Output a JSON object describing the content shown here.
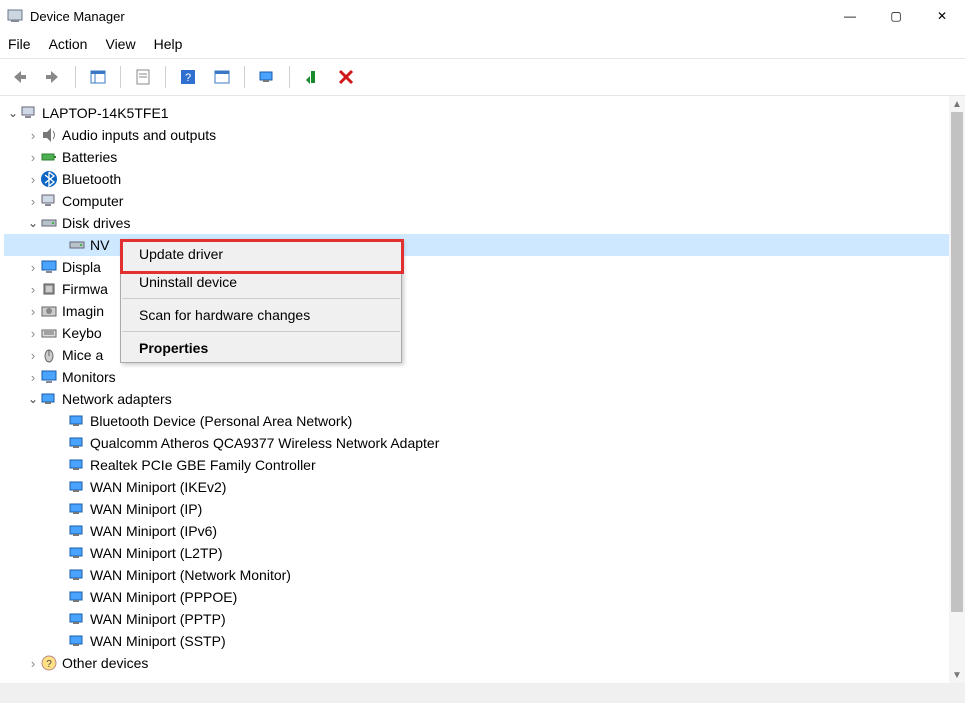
{
  "window": {
    "title": "Device Manager",
    "controls": {
      "min": "—",
      "max": "▢",
      "close": "✕"
    }
  },
  "menu": {
    "file": "File",
    "action": "Action",
    "view": "View",
    "help": "Help"
  },
  "tree": {
    "root": "LAPTOP-14K5TFE1",
    "audio": "Audio inputs and outputs",
    "batteries": "Batteries",
    "bluetooth": "Bluetooth",
    "computer": "Computer",
    "diskdrives": "Disk drives",
    "disk_item": "NV",
    "display": "Displa",
    "firmware": "Firmwa",
    "imaging": "Imagin",
    "keyboards": "Keybo",
    "mice": "Mice a",
    "monitors": "Monitors",
    "netadapters": "Network adapters",
    "net": {
      "btpan": "Bluetooth Device (Personal Area Network)",
      "qca": "Qualcomm Atheros QCA9377 Wireless Network Adapter",
      "realtek": "Realtek PCIe GBE Family Controller",
      "ikev2": "WAN Miniport (IKEv2)",
      "ip": "WAN Miniport (IP)",
      "ipv6": "WAN Miniport (IPv6)",
      "l2tp": "WAN Miniport (L2TP)",
      "netmon": "WAN Miniport (Network Monitor)",
      "pppoe": "WAN Miniport (PPPOE)",
      "pptp": "WAN Miniport (PPTP)",
      "sstp": "WAN Miniport (SSTP)"
    },
    "other": "Other devices"
  },
  "context_menu": {
    "update": "Update driver",
    "uninstall": "Uninstall device",
    "scan": "Scan for hardware changes",
    "properties": "Properties"
  }
}
